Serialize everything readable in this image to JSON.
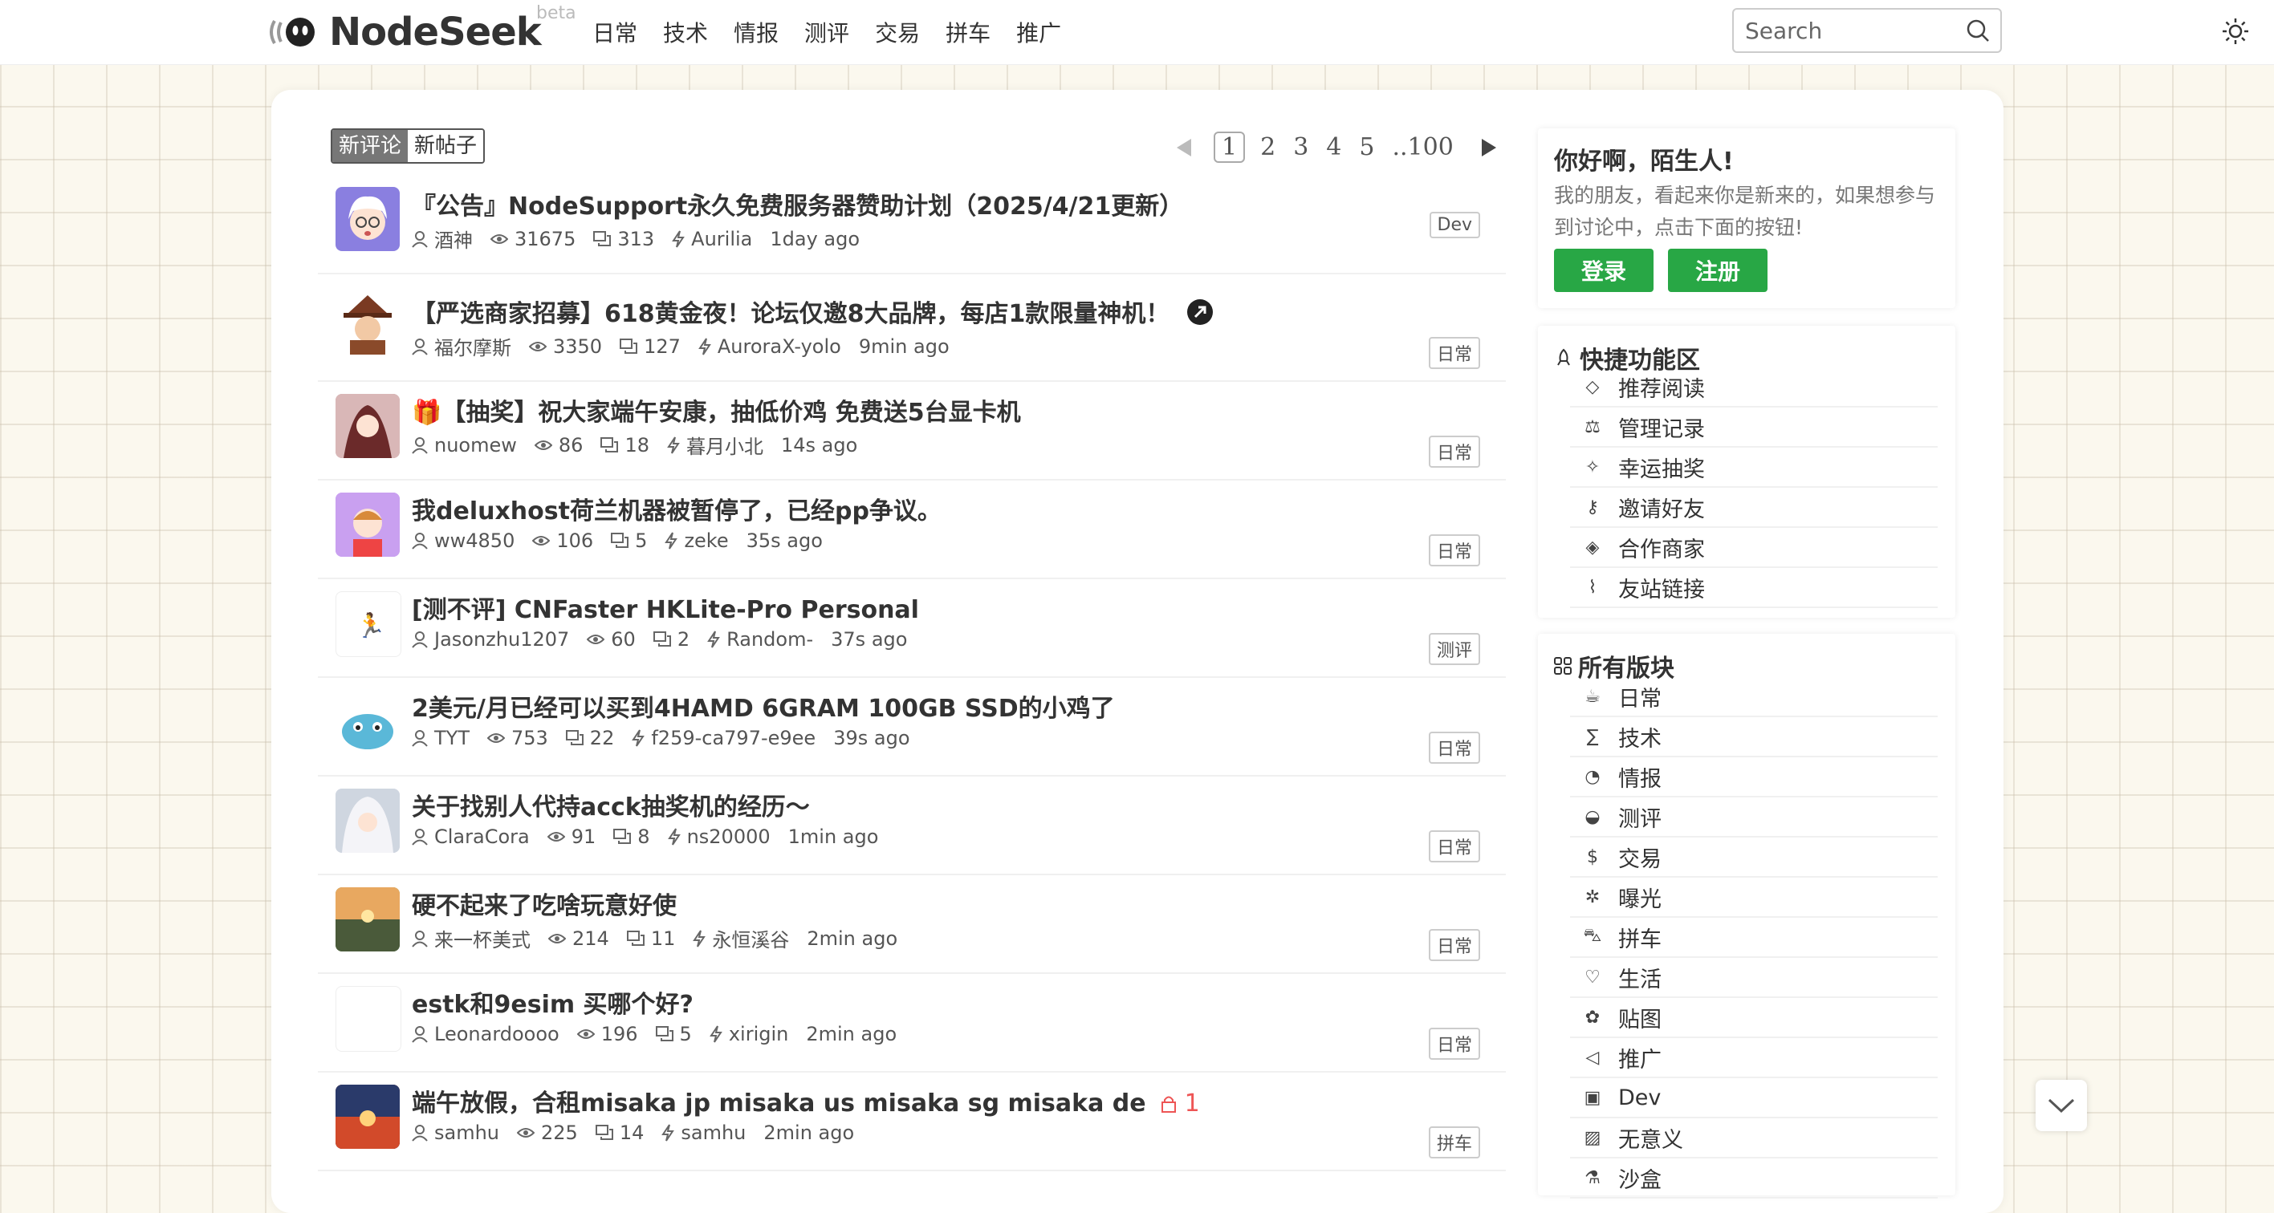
{
  "brand": {
    "name": "NodeSeek",
    "beta": "beta"
  },
  "nav": [
    "日常",
    "技术",
    "情报",
    "测评",
    "交易",
    "拼车",
    "推广"
  ],
  "search": {
    "placeholder": "Search"
  },
  "tabs": {
    "new_comments": "新评论",
    "new_posts": "新帖子"
  },
  "pagination": {
    "pages": [
      "1",
      "2",
      "3",
      "4",
      "5"
    ],
    "ellipsis_last": "..100"
  },
  "posts": [
    {
      "title": "『公告』NodeSupport永久免费服务器赞助计划（2025/4/21更新）",
      "author": "酒神",
      "views": "31675",
      "comments": "313",
      "last_replier": "Aurilia",
      "time": "1day ago",
      "tag": "Dev"
    },
    {
      "title": "【严选商家招募】618黄金夜！论坛仅邀8大品牌，每店1款限量神机！",
      "author": "福尔摩斯",
      "views": "3350",
      "comments": "127",
      "last_replier": "AuroraX-yolo",
      "time": "9min ago",
      "tag": "日常"
    },
    {
      "title": "🎁【抽奖】祝大家端午安康，抽低价鸡 免费送5台显卡机",
      "author": "nuomew",
      "views": "86",
      "comments": "18",
      "last_replier": "暮月小北",
      "time": "14s ago",
      "tag": "日常"
    },
    {
      "title": "我deluxhost荷兰机器被暂停了，已经pp争议。",
      "author": "ww4850",
      "views": "106",
      "comments": "5",
      "last_replier": "zeke",
      "time": "35s ago",
      "tag": "日常"
    },
    {
      "title": "[测不评] CNFaster HKLite-Pro Personal",
      "author": "Jasonzhu1207",
      "views": "60",
      "comments": "2",
      "last_replier": "Random-",
      "time": "37s ago",
      "tag": "测评"
    },
    {
      "title": "2美元/月已经可以买到4HAMD 6GRAM 100GB SSD的小鸡了",
      "author": "TYT",
      "views": "753",
      "comments": "22",
      "last_replier": "f259-ca797-e9ee",
      "time": "39s ago",
      "tag": "日常"
    },
    {
      "title": "关于找别人代持acck抽奖机的经历～",
      "author": "ClaraCora",
      "views": "91",
      "comments": "8",
      "last_replier": "ns20000",
      "time": "1min ago",
      "tag": "日常"
    },
    {
      "title": "硬不起来了吃啥玩意好使",
      "author": "来一杯美式",
      "views": "214",
      "comments": "11",
      "last_replier": "永恒溪谷",
      "time": "2min ago",
      "tag": "日常"
    },
    {
      "title": "estk和9esim 买哪个好?",
      "author": "Leonardoooo",
      "views": "196",
      "comments": "5",
      "last_replier": "xirigin",
      "time": "2min ago",
      "tag": "日常"
    },
    {
      "title": "端午放假，合租misaka jp misaka us misaka sg misaka de",
      "lock_count": "1",
      "author": "samhu",
      "views": "225",
      "comments": "14",
      "last_replier": "samhu",
      "time": "2min ago",
      "tag": "拼车"
    }
  ],
  "welcome": {
    "title": "你好啊，陌生人!",
    "text": "我的朋友，看起来你是新来的，如果想参与到讨论中，点击下面的按钮!",
    "login": "登录",
    "register": "注册"
  },
  "quick": {
    "title": "快捷功能区",
    "items": [
      {
        "label": "推荐阅读",
        "icon": "diamond-icon"
      },
      {
        "label": "管理记录",
        "icon": "scale-icon"
      },
      {
        "label": "幸运抽奖",
        "icon": "sparkle-icon"
      },
      {
        "label": "邀请好友",
        "icon": "key-icon"
      },
      {
        "label": "合作商家",
        "icon": "handshake-icon"
      },
      {
        "label": "友站链接",
        "icon": "paperclip-icon"
      }
    ]
  },
  "boards": {
    "title": "所有版块",
    "items": [
      {
        "label": "日常",
        "icon": "cup-icon"
      },
      {
        "label": "技术",
        "icon": "sigma-icon"
      },
      {
        "label": "情报",
        "icon": "satellite-icon"
      },
      {
        "label": "测评",
        "icon": "gauge-icon"
      },
      {
        "label": "交易",
        "icon": "dollar-icon"
      },
      {
        "label": "曝光",
        "icon": "bug-icon"
      },
      {
        "label": "拼车",
        "icon": "car-icon"
      },
      {
        "label": "生活",
        "icon": "leaf-icon"
      },
      {
        "label": "贴图",
        "icon": "palette-icon"
      },
      {
        "label": "推广",
        "icon": "megaphone-icon"
      },
      {
        "label": "Dev",
        "icon": "terminal-icon"
      },
      {
        "label": "无意义",
        "icon": "stripes-icon"
      },
      {
        "label": "沙盒",
        "icon": "flask-icon"
      }
    ]
  },
  "colors": {
    "accent_green": "#28a745",
    "lock_red": "#e55",
    "grid_bg": "#fbf8ee"
  }
}
